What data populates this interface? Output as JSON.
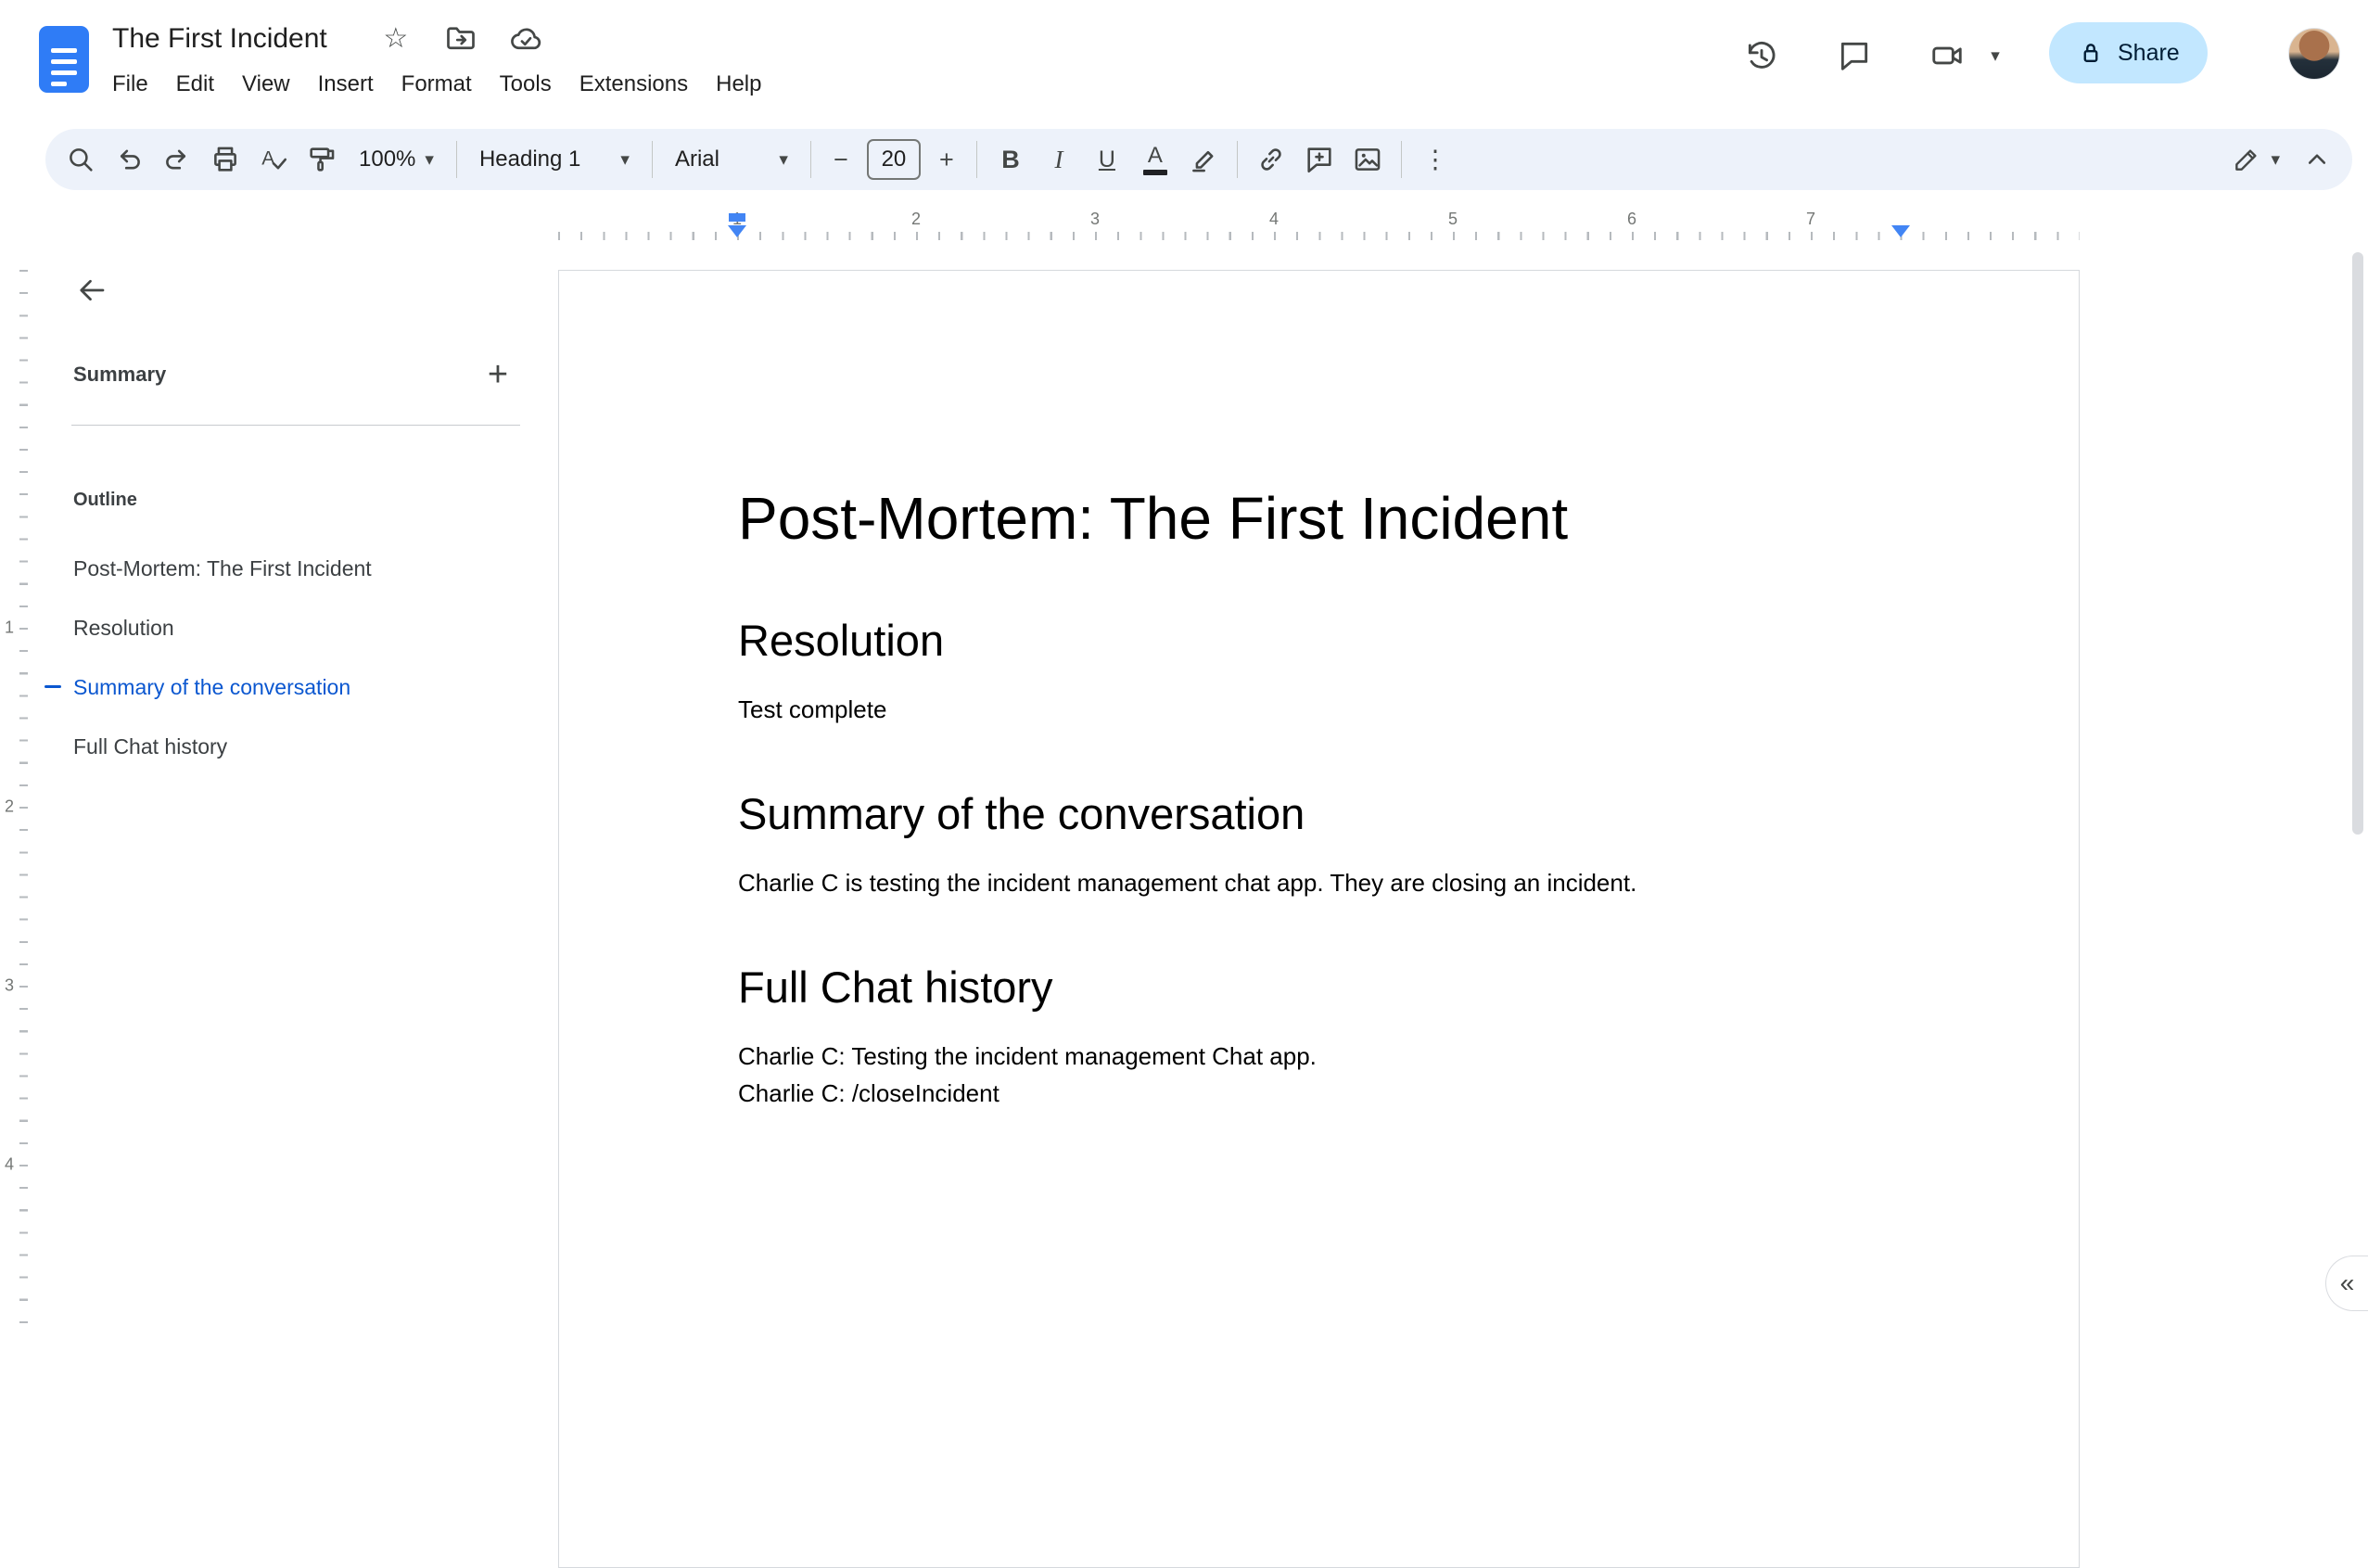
{
  "app": {
    "title": "The First Incident",
    "menus": [
      "File",
      "Edit",
      "View",
      "Insert",
      "Format",
      "Tools",
      "Extensions",
      "Help"
    ],
    "share_label": "Share"
  },
  "toolbar": {
    "zoom_value": "100%",
    "style_value": "Heading 1",
    "font_value": "Arial",
    "font_size_value": "20",
    "bold_label": "B",
    "italic_label": "I",
    "underline_label": "U",
    "text_color_label": "A"
  },
  "icons": {
    "star": "☆",
    "caret": "▾",
    "more_vertical": "⋮",
    "minus": "−",
    "plus": "+",
    "add": "+",
    "collapse": "«"
  },
  "ruler": {
    "h_labels": [
      "1",
      "2",
      "3",
      "4",
      "5",
      "6",
      "7"
    ],
    "v_labels": [
      "1",
      "2",
      "3",
      "4"
    ]
  },
  "sidebar": {
    "summary_label": "Summary",
    "outline_label": "Outline",
    "items": [
      {
        "label": "Post-Mortem: The First Incident",
        "active": false
      },
      {
        "label": "Resolution",
        "active": false
      },
      {
        "label": "Summary of the conversation",
        "active": true
      },
      {
        "label": "Full Chat history",
        "active": false
      }
    ]
  },
  "doc": {
    "title": "Post-Mortem: The First Incident",
    "sections": [
      {
        "heading": "Resolution",
        "paragraphs": [
          "Test complete"
        ]
      },
      {
        "heading": "Summary of the conversation",
        "paragraphs": [
          "Charlie C is testing the incident management chat app. They are closing an incident."
        ]
      },
      {
        "heading": "Full Chat history",
        "paragraphs": [
          "Charlie C: Testing the incident management Chat app.",
          "Charlie C: /closeIncident"
        ]
      }
    ]
  },
  "colors": {
    "accent_blue": "#0b57d0",
    "share_background": "#c2e7ff",
    "share_text": "#001d35",
    "toolbar_background": "#edf2fa",
    "icon_gray": "#444746",
    "ruler_marker_blue": "#4285f4",
    "docs_logo_blue": "#2f7cf6"
  }
}
